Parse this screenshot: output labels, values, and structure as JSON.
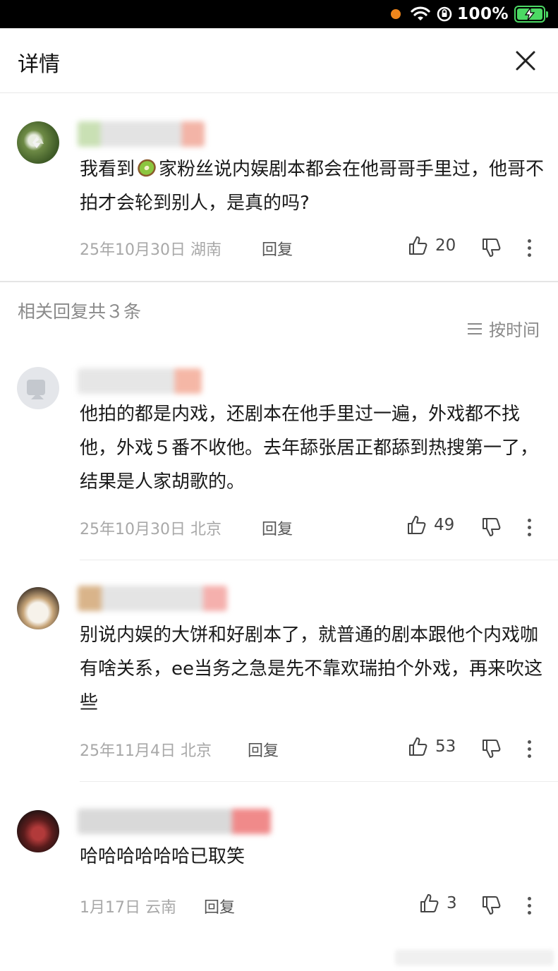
{
  "status_bar": {
    "battery_text": "100%"
  },
  "header": {
    "title": "详情"
  },
  "main_comment": {
    "text_before_emoji": "我看到",
    "text_after_emoji": "家粉丝说内娱剧本都会在他哥哥手里过，他哥不拍才会轮到别人，是真的吗?",
    "date": "25年10月30日",
    "location": "湖南",
    "reply_label": "回复",
    "likes": "20"
  },
  "replies_section": {
    "title": "相关回复共３条",
    "sort_label": "按时间"
  },
  "replies": [
    {
      "text": "他拍的都是内戏，还剧本在他手里过一遍，外戏都不找他，外戏５番不收他。去年舔张居正都舔到热搜第一了，结果是人家胡歌的。",
      "date": "25年10月30日",
      "location": "北京",
      "reply_label": "回复",
      "likes": "49"
    },
    {
      "text": "别说内娱的大饼和好剧本了，就普通的剧本跟他个内戏咖有啥关系，ee当务之急是先不靠欢瑞拍个外戏，再来吹这些",
      "date": "25年11月4日",
      "location": "北京",
      "reply_label": "回复",
      "likes": "53"
    },
    {
      "text": "哈哈哈哈哈哈已取笑",
      "date": "1月17日",
      "location": "云南",
      "reply_label": "回复",
      "likes": "3"
    }
  ],
  "colors": {
    "accent_orange": "#f0861c",
    "battery_green": "#4cd964",
    "meta_grey": "#a8a8a8"
  }
}
